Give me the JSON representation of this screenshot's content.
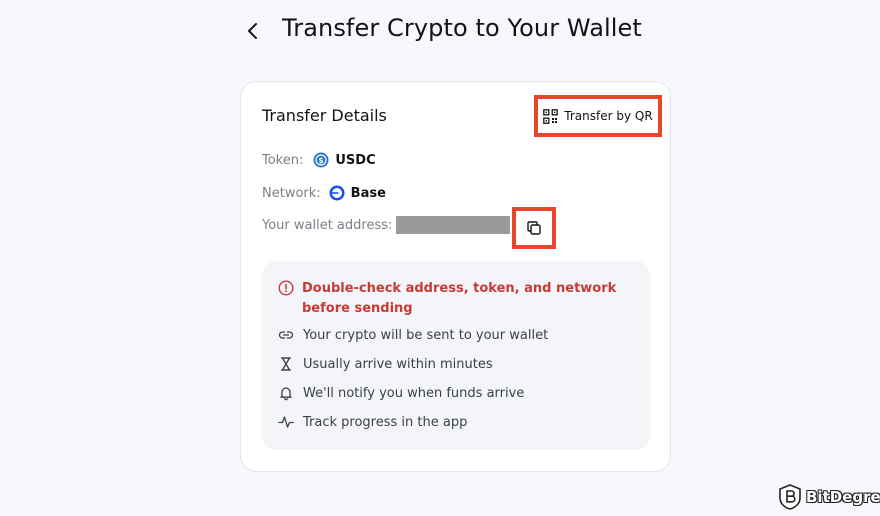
{
  "header": {
    "title": "Transfer Crypto to Your Wallet",
    "back_icon": "chevron-left-icon"
  },
  "card": {
    "title": "Transfer Details",
    "qr_button_label": "Transfer by QR",
    "token": {
      "label": "Token:",
      "value": "USDC",
      "icon": "usdc-icon"
    },
    "network": {
      "label": "Network:",
      "value": "Base",
      "icon": "base-network-icon"
    },
    "wallet": {
      "label": "Your wallet address:",
      "copy_icon": "copy-icon"
    }
  },
  "info": {
    "warning": "Double-check address, token, and network before sending",
    "items": [
      {
        "icon": "link-icon",
        "text": "Your crypto will be sent to your wallet"
      },
      {
        "icon": "hourglass-icon",
        "text": "Usually arrive within minutes"
      },
      {
        "icon": "bell-icon",
        "text": "We'll notify you when funds arrive"
      },
      {
        "icon": "activity-icon",
        "text": "Track progress in the app"
      }
    ]
  },
  "colors": {
    "highlight": "#e8452c",
    "warning": "#c93a37",
    "usdc": "#2775ca",
    "base": "#1652f0"
  },
  "watermark": {
    "text": "BitDegree"
  }
}
